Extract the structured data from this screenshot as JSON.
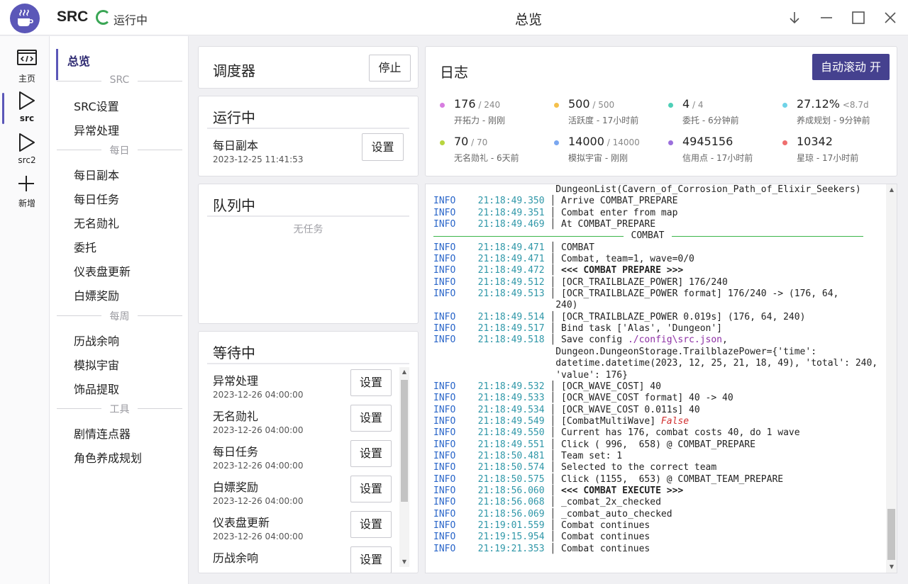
{
  "app": {
    "name": "SRC",
    "status": "运行中",
    "window_title": "总览"
  },
  "nav": [
    {
      "label": "主页",
      "icon": "code-window-icon"
    },
    {
      "label": "src",
      "icon": "play-icon",
      "active": true
    },
    {
      "label": "src2",
      "icon": "play-icon"
    },
    {
      "label": "新增",
      "icon": "plus-icon"
    }
  ],
  "sidebar": {
    "active": "总览",
    "groups": [
      {
        "title": "SRC",
        "items": [
          "SRC设置",
          "异常处理"
        ]
      },
      {
        "title": "每日",
        "items": [
          "每日副本",
          "每日任务",
          "无名勋礼",
          "委托",
          "仪表盘更新",
          "白嫖奖励"
        ]
      },
      {
        "title": "每周",
        "items": [
          "历战余响",
          "模拟宇宙",
          "饰品提取"
        ]
      },
      {
        "title": "工具",
        "items": [
          "剧情连点器",
          "角色养成规划"
        ]
      }
    ]
  },
  "scheduler": {
    "title": "调度器",
    "stop_label": "停止"
  },
  "running": {
    "title": "运行中",
    "task": {
      "name": "每日副本",
      "time": "2023-12-25 11:41:53"
    },
    "settings_label": "设置"
  },
  "queue": {
    "title": "队列中",
    "empty_text": "无任务"
  },
  "waiting": {
    "title": "等待中",
    "settings_label": "设置",
    "tasks": [
      {
        "name": "异常处理",
        "time": "2023-12-26 04:00:00"
      },
      {
        "name": "无名勋礼",
        "time": "2023-12-26 04:00:00"
      },
      {
        "name": "每日任务",
        "time": "2023-12-26 04:00:00"
      },
      {
        "name": "白嫖奖励",
        "time": "2023-12-26 04:00:00"
      },
      {
        "name": "仪表盘更新",
        "time": "2023-12-26 04:00:00"
      },
      {
        "name": "历战余响",
        "time": ""
      }
    ]
  },
  "log_panel": {
    "title": "日志",
    "autoscroll_label": "自动滚动 开",
    "stats": [
      {
        "value": "176",
        "max": " / 240",
        "label": "开拓力 - 刚刚",
        "color": "#d77de0"
      },
      {
        "value": "500",
        "max": " / 500",
        "label": "活跃度 - 17小时前",
        "color": "#f4c04b"
      },
      {
        "value": "4",
        "max": " / 4",
        "label": "委托 - 6分钟前",
        "color": "#4ecfb7"
      },
      {
        "value": "27.12%",
        "max": " <8.7d",
        "label": "养成规划 - 9分钟前",
        "color": "#6fd3e8"
      },
      {
        "value": "70",
        "max": " / 70",
        "label": "无名勋礼 - 6天前",
        "color": "#b8d53f"
      },
      {
        "value": "14000",
        "max": " / 14000",
        "label": "模拟宇宙 - 刚刚",
        "color": "#7aa7f0"
      },
      {
        "value": "4945156",
        "max": "",
        "label": "信用点 - 17小时前",
        "color": "#9b6fdc"
      },
      {
        "value": "10342",
        "max": "",
        "label": "星琼 - 17小时前",
        "color": "#ef6e6e"
      }
    ]
  },
  "log": [
    {
      "t": "",
      "m": "DungeonList(Cavern_of_Corrosion_Path_of_Elixir_Seekers)",
      "cont": true
    },
    {
      "t": "21:18:49.350",
      "m": "Arrive COMBAT_PREPARE"
    },
    {
      "t": "21:18:49.351",
      "m": "Combat enter from map"
    },
    {
      "t": "21:18:49.469",
      "m": "At COMBAT_PREPARE"
    },
    {
      "rule": "COMBAT"
    },
    {
      "t": "21:18:49.471",
      "m": "COMBAT"
    },
    {
      "t": "21:18:49.471",
      "m": "Combat, team=1, wave=0/0"
    },
    {
      "t": "21:18:49.472",
      "m": "<<< COMBAT PREPARE >>>",
      "style": "bold"
    },
    {
      "t": "21:18:49.512",
      "m": "[OCR_TRAILBLAZE_POWER] 176/240"
    },
    {
      "t": "21:18:49.513",
      "m": "[OCR_TRAILBLAZE_POWER format] 176/240 -> (176, 64,"
    },
    {
      "t": "",
      "m": "240)",
      "cont": true
    },
    {
      "t": "21:18:49.514",
      "m": "[OCR_TRAILBLAZE_POWER 0.019s] (176, 64, 240)"
    },
    {
      "t": "21:18:49.517",
      "m": "Bind task ['Alas', 'Dungeon']"
    },
    {
      "t": "21:18:49.518",
      "m": "Save config ",
      "path": "./config\\src.json",
      "after": ","
    },
    {
      "t": "",
      "m": "Dungeon.DungeonStorage.TrailblazePower={'time':",
      "cont": true
    },
    {
      "t": "",
      "m": "datetime.datetime(2023, 12, 25, 21, 18, 49), 'total': 240,",
      "cont": true
    },
    {
      "t": "",
      "m": "'value': 176}",
      "cont": true
    },
    {
      "t": "21:18:49.532",
      "m": "[OCR_WAVE_COST] 40"
    },
    {
      "t": "21:18:49.533",
      "m": "[OCR_WAVE_COST format] 40 -> 40"
    },
    {
      "t": "21:18:49.534",
      "m": "[OCR_WAVE_COST 0.011s] 40"
    },
    {
      "t": "21:18:49.549",
      "m": "[CombatMultiWave] ",
      "false": "False"
    },
    {
      "t": "21:18:49.550",
      "m": "Current has 176, combat costs 40, do 1 wave"
    },
    {
      "t": "21:18:49.551",
      "m": "Click ( 996,  658) @ COMBAT_PREPARE"
    },
    {
      "t": "21:18:50.481",
      "m": "Team set: 1"
    },
    {
      "t": "21:18:50.574",
      "m": "Selected to the correct team"
    },
    {
      "t": "21:18:50.575",
      "m": "Click (1155,  653) @ COMBAT_TEAM_PREPARE"
    },
    {
      "t": "21:18:56.060",
      "m": "<<< COMBAT EXECUTE >>>",
      "style": "bold"
    },
    {
      "t": "21:18:56.068",
      "m": "_combat_2x_checked"
    },
    {
      "t": "21:18:56.069",
      "m": "_combat_auto_checked"
    },
    {
      "t": "21:19:01.559",
      "m": "Combat continues"
    },
    {
      "t": "21:19:15.954",
      "m": "Combat continues"
    },
    {
      "t": "21:19:21.353",
      "m": "Combat continues"
    }
  ],
  "log_level": "INFO"
}
